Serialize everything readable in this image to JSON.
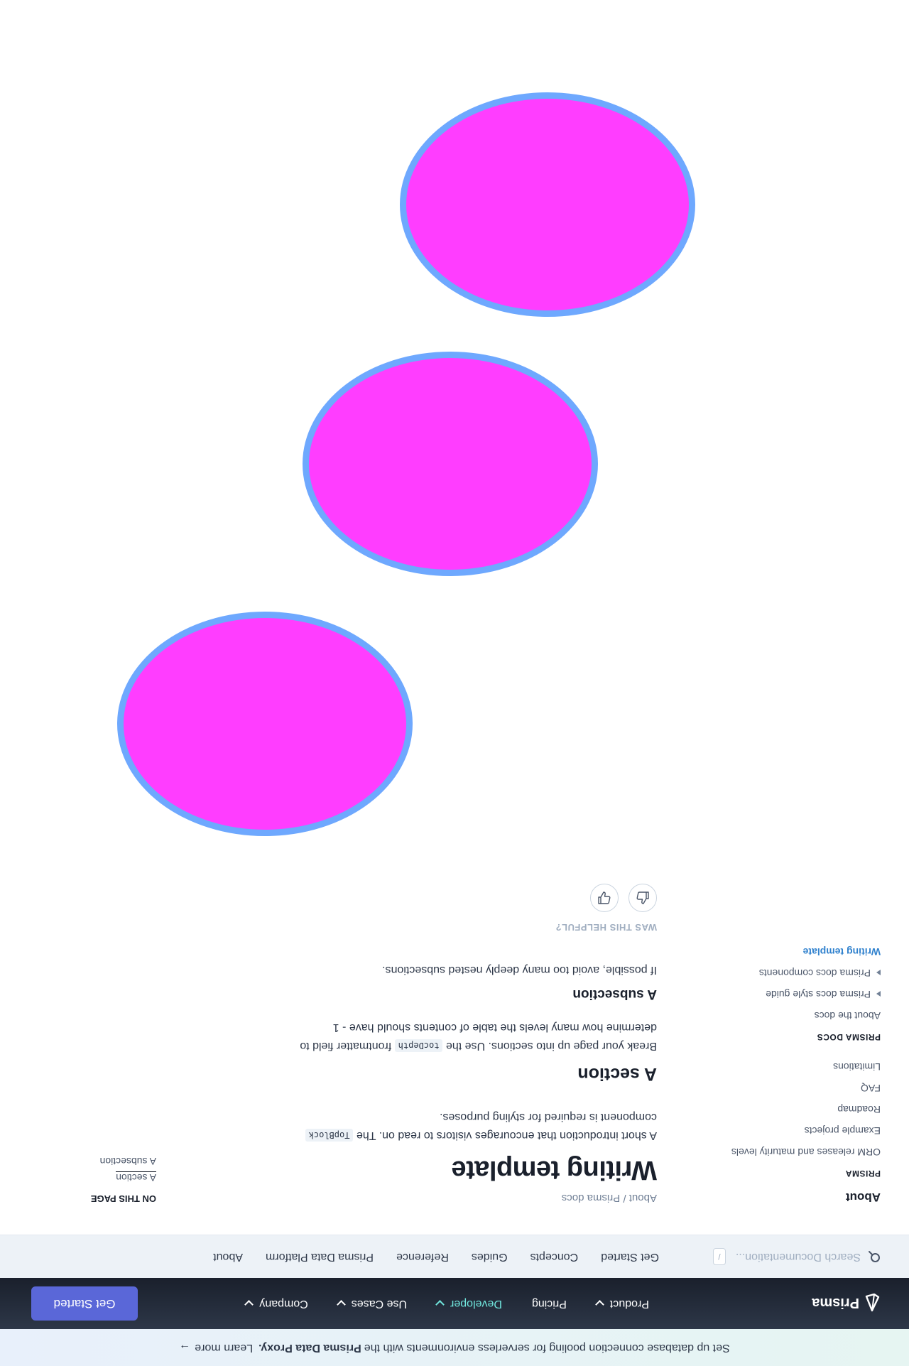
{
  "banner": {
    "pre": "Set up database connection pooling for serverless environments with the",
    "bold": "Prisma Data Proxy.",
    "learn": "Learn more",
    "arrow": "→"
  },
  "topnav": {
    "logo": "Prisma",
    "links": [
      "Product",
      "Pricing",
      "Developer",
      "Use Cases",
      "Company"
    ],
    "cta": "Get Started"
  },
  "subnav": {
    "search_placeholder": "Search Documentation...",
    "shortcut": "/",
    "items": [
      "Get Started",
      "Concepts",
      "Guides",
      "Reference",
      "Prisma Data Platform",
      "About"
    ]
  },
  "sidebar": {
    "title": "About",
    "section1": "PRISMA",
    "items1": [
      "ORM releases and maturity levels",
      "Example projects",
      "Roadmap",
      "FAQ",
      "Limitations"
    ],
    "section2": "PRISMA DOCS",
    "items2": [
      "About the docs",
      "Prisma docs style guide",
      "Prisma docs components",
      "Writing template"
    ]
  },
  "main": {
    "breadcrumb": "About / Prisma docs",
    "title": "Writing template",
    "intro1": "A short introduction that encourages visitors to read on. The",
    "intro_code": "TopBlock",
    "intro2": "component is required for styling purposes.",
    "section_title": "A section",
    "section_p1": "Break your page up into sections. Use the",
    "section_code": "tocDepth",
    "section_p2": "frontmatter field to determine how many levels the table of contents should have - 1",
    "subsection_title": "A subsection",
    "subsection_p": "If possible, avoid too many deeply nested subsections.",
    "helpful": "WAS THIS HELPFUL?"
  },
  "toc": {
    "title": "ON THIS PAGE",
    "items": [
      "A section",
      "A subsection"
    ]
  }
}
